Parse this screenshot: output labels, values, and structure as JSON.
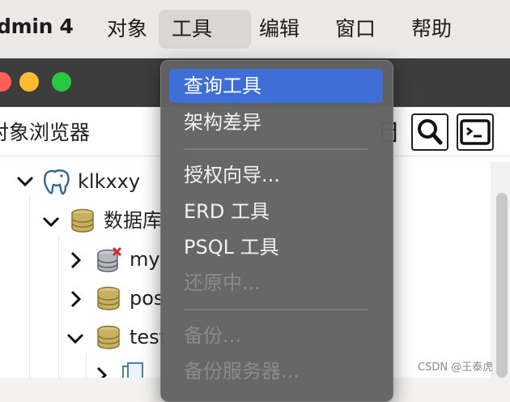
{
  "menubar": {
    "app_name": "dmin 4",
    "items": [
      {
        "label": "对象",
        "active": false
      },
      {
        "label": "工具",
        "active": true
      },
      {
        "label": "编辑",
        "active": false
      },
      {
        "label": "窗口",
        "active": false
      },
      {
        "label": "帮助",
        "active": false
      }
    ]
  },
  "browser": {
    "title": "对象浏览器"
  },
  "tree": {
    "nodes": [
      {
        "label": "klkxxy",
        "icon": "postgres-elephant-icon",
        "expanded": true
      },
      {
        "label": "数据库",
        "icon": "database-icon",
        "expanded": true
      },
      {
        "label": "my",
        "icon": "database-disconnected-icon",
        "expanded": false
      },
      {
        "label": "pos",
        "icon": "database-icon",
        "expanded": false
      },
      {
        "label": "test",
        "icon": "database-icon",
        "expanded": true
      },
      {
        "label": "",
        "icon": "schema-icon",
        "expanded": false
      }
    ]
  },
  "dropdown": {
    "items": [
      {
        "label": "查询工具",
        "state": "highlight"
      },
      {
        "label": "架构差异",
        "state": "normal"
      },
      {
        "label": "授权向导...",
        "state": "normal"
      },
      {
        "label": "ERD 工具",
        "state": "normal"
      },
      {
        "label": "PSQL 工具",
        "state": "normal"
      },
      {
        "label": "还原中...",
        "state": "disabled"
      },
      {
        "label": "备份...",
        "state": "disabled"
      },
      {
        "label": "备份服务器...",
        "state": "disabled"
      }
    ]
  },
  "watermark": "CSDN @王泰虎",
  "colors": {
    "highlight": "#3d6fd6",
    "database_gold": "#b8a050",
    "pg_blue": "#336791",
    "error_red": "#d42a2a"
  }
}
